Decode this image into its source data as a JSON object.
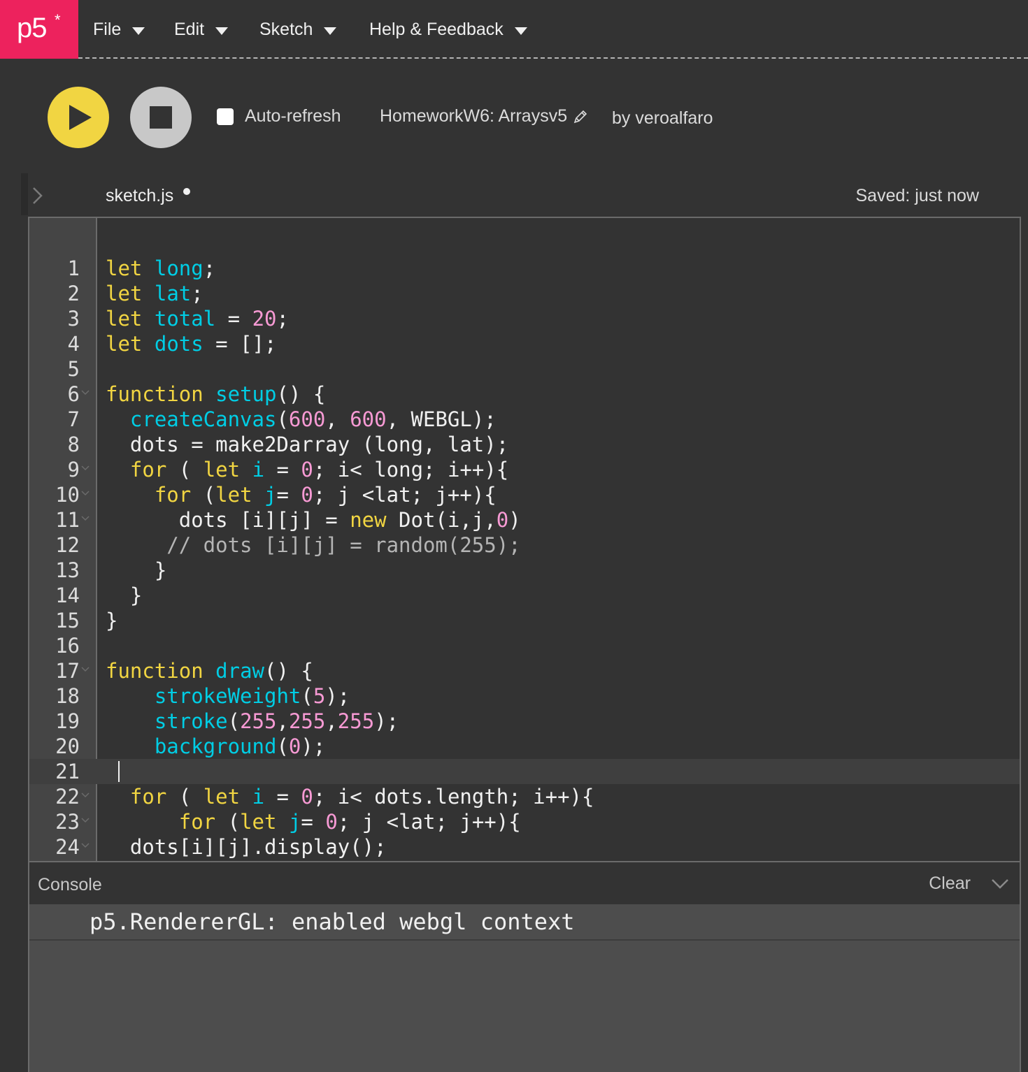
{
  "app": {
    "logo": "p5",
    "logo_star": "*"
  },
  "menu": [
    {
      "label": "File"
    },
    {
      "label": "Edit"
    },
    {
      "label": "Sketch"
    },
    {
      "label": "Help & Feedback"
    }
  ],
  "toolbar": {
    "auto_refresh_label": "Auto-refresh",
    "auto_refresh_checked": false,
    "sketch_name": "HomeworkW6: Arraysv5",
    "by_user": "by veroalfaro"
  },
  "editor": {
    "file_tab": "sketch.js",
    "saved_status": "Saved: just now",
    "active_line": 21,
    "lines": [
      {
        "n": "1",
        "tokens": [
          [
            "let",
            "yel"
          ],
          [
            " ",
            "white"
          ],
          [
            "long",
            "cyan"
          ],
          [
            ";",
            "white"
          ]
        ]
      },
      {
        "n": "2",
        "tokens": [
          [
            "let",
            "yel"
          ],
          [
            " ",
            "white"
          ],
          [
            "lat",
            "cyan"
          ],
          [
            ";",
            "white"
          ]
        ]
      },
      {
        "n": "3",
        "tokens": [
          [
            "let",
            "yel"
          ],
          [
            " ",
            "white"
          ],
          [
            "total",
            "cyan"
          ],
          [
            " = ",
            "white"
          ],
          [
            "20",
            "pink"
          ],
          [
            ";",
            "white"
          ]
        ]
      },
      {
        "n": "4",
        "tokens": [
          [
            "let",
            "yel"
          ],
          [
            " ",
            "white"
          ],
          [
            "dots",
            "cyan"
          ],
          [
            " = [];",
            "white"
          ]
        ]
      },
      {
        "n": "5",
        "tokens": []
      },
      {
        "n": "6",
        "fold": true,
        "tokens": [
          [
            "function",
            "yel"
          ],
          [
            " ",
            "white"
          ],
          [
            "setup",
            "cyan"
          ],
          [
            "() {",
            "white"
          ]
        ]
      },
      {
        "n": "7",
        "tokens": [
          [
            "  ",
            "white"
          ],
          [
            "createCanvas",
            "cyan"
          ],
          [
            "(",
            "white"
          ],
          [
            "600",
            "pink"
          ],
          [
            ", ",
            "white"
          ],
          [
            "600",
            "pink"
          ],
          [
            ", WEBGL);",
            "white"
          ]
        ]
      },
      {
        "n": "8",
        "tokens": [
          [
            "  dots = make2Darray (long, lat);",
            "white"
          ]
        ]
      },
      {
        "n": "9",
        "fold": true,
        "tokens": [
          [
            "  ",
            "white"
          ],
          [
            "for",
            "yel"
          ],
          [
            " ( ",
            "white"
          ],
          [
            "let",
            "yel"
          ],
          [
            " ",
            "white"
          ],
          [
            "i",
            "cyan"
          ],
          [
            " = ",
            "white"
          ],
          [
            "0",
            "pink"
          ],
          [
            "; i< long; i++){",
            "white"
          ]
        ]
      },
      {
        "n": "10",
        "fold": true,
        "tokens": [
          [
            "    ",
            "white"
          ],
          [
            "for",
            "yel"
          ],
          [
            " (",
            "white"
          ],
          [
            "let",
            "yel"
          ],
          [
            " ",
            "white"
          ],
          [
            "j",
            "cyan"
          ],
          [
            "= ",
            "white"
          ],
          [
            "0",
            "pink"
          ],
          [
            "; j <lat; j++){",
            "white"
          ]
        ]
      },
      {
        "n": "11",
        "fold": true,
        "tokens": [
          [
            "      dots [i][j] = ",
            "white"
          ],
          [
            "new",
            "yel"
          ],
          [
            " Dot(i,j,",
            "white"
          ],
          [
            "0",
            "pink"
          ],
          [
            ")",
            "white"
          ]
        ]
      },
      {
        "n": "12",
        "tokens": [
          [
            "     // dots [i][j] = random(255);",
            "gray"
          ]
        ]
      },
      {
        "n": "13",
        "tokens": [
          [
            "    }",
            "white"
          ]
        ]
      },
      {
        "n": "14",
        "tokens": [
          [
            "  }",
            "white"
          ]
        ]
      },
      {
        "n": "15",
        "tokens": [
          [
            "}",
            "white"
          ]
        ]
      },
      {
        "n": "16",
        "tokens": []
      },
      {
        "n": "17",
        "fold": true,
        "tokens": [
          [
            "function",
            "yel"
          ],
          [
            " ",
            "white"
          ],
          [
            "draw",
            "cyan"
          ],
          [
            "() {",
            "white"
          ]
        ]
      },
      {
        "n": "18",
        "tokens": [
          [
            "    ",
            "white"
          ],
          [
            "strokeWeight",
            "cyan"
          ],
          [
            "(",
            "white"
          ],
          [
            "5",
            "pink"
          ],
          [
            ");",
            "white"
          ]
        ]
      },
      {
        "n": "19",
        "tokens": [
          [
            "    ",
            "white"
          ],
          [
            "stroke",
            "cyan"
          ],
          [
            "(",
            "white"
          ],
          [
            "255",
            "pink"
          ],
          [
            ",",
            "white"
          ],
          [
            "255",
            "pink"
          ],
          [
            ",",
            "white"
          ],
          [
            "255",
            "pink"
          ],
          [
            ");",
            "white"
          ]
        ]
      },
      {
        "n": "20",
        "tokens": [
          [
            "    ",
            "white"
          ],
          [
            "background",
            "cyan"
          ],
          [
            "(",
            "white"
          ],
          [
            "0",
            "pink"
          ],
          [
            ");",
            "white"
          ]
        ]
      },
      {
        "n": "21",
        "tokens": []
      },
      {
        "n": "22",
        "fold": true,
        "tokens": [
          [
            "  ",
            "white"
          ],
          [
            "for",
            "yel"
          ],
          [
            " ( ",
            "white"
          ],
          [
            "let",
            "yel"
          ],
          [
            " ",
            "white"
          ],
          [
            "i",
            "cyan"
          ],
          [
            " = ",
            "white"
          ],
          [
            "0",
            "pink"
          ],
          [
            "; i< dots.length; i++){",
            "white"
          ]
        ]
      },
      {
        "n": "23",
        "fold": true,
        "tokens": [
          [
            "      ",
            "white"
          ],
          [
            "for",
            "yel"
          ],
          [
            " (",
            "white"
          ],
          [
            "let",
            "yel"
          ],
          [
            " ",
            "white"
          ],
          [
            "j",
            "cyan"
          ],
          [
            "= ",
            "white"
          ],
          [
            "0",
            "pink"
          ],
          [
            "; j <lat; j++){",
            "white"
          ]
        ]
      },
      {
        "n": "24",
        "fold": true,
        "tokens": [
          [
            "  dots[i][j].display();",
            "white"
          ]
        ]
      }
    ]
  },
  "console": {
    "title": "Console",
    "clear_label": "Clear",
    "messages": [
      "p5.RendererGL: enabled webgl context"
    ]
  },
  "colors": {
    "brand": "#ed225d",
    "play": "#f1d542",
    "keyword": "#f1d542",
    "identifier": "#00cde4",
    "number": "#f79ad4",
    "comment": "#b5b5b5"
  },
  "icons": {
    "play": "play-icon",
    "stop": "stop-icon",
    "pencil": "pencil-icon",
    "expand": "chevron-right-icon",
    "console_collapse": "chevron-down-icon",
    "fold": "fold-chevron-icon"
  }
}
